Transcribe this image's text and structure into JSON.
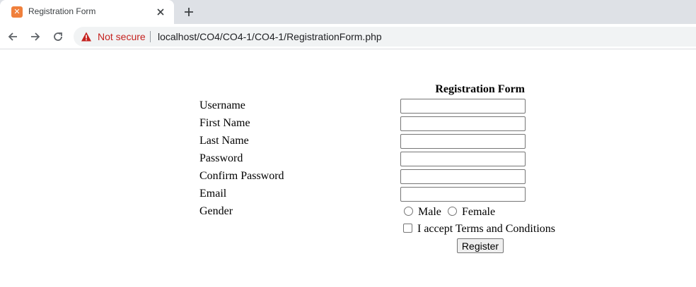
{
  "browser": {
    "tab_title": "Registration Form",
    "security_label": "Not secure",
    "url": "localhost/CO4/CO4-1/CO4-1/RegistrationForm.php"
  },
  "form": {
    "title": "Registration Form",
    "fields": {
      "username": {
        "label": "Username",
        "value": ""
      },
      "first_name": {
        "label": "First Name",
        "value": ""
      },
      "last_name": {
        "label": "Last Name",
        "value": ""
      },
      "password": {
        "label": "Password",
        "value": ""
      },
      "confirm_password": {
        "label": "Confirm Password",
        "value": ""
      },
      "email": {
        "label": "Email",
        "value": ""
      }
    },
    "gender": {
      "label": "Gender",
      "options": [
        "Male",
        "Female"
      ]
    },
    "terms_label": "I accept Terms and Conditions",
    "register_label": "Register"
  },
  "colors": {
    "warning": "#c5221f",
    "favicon": "#f0803c"
  }
}
